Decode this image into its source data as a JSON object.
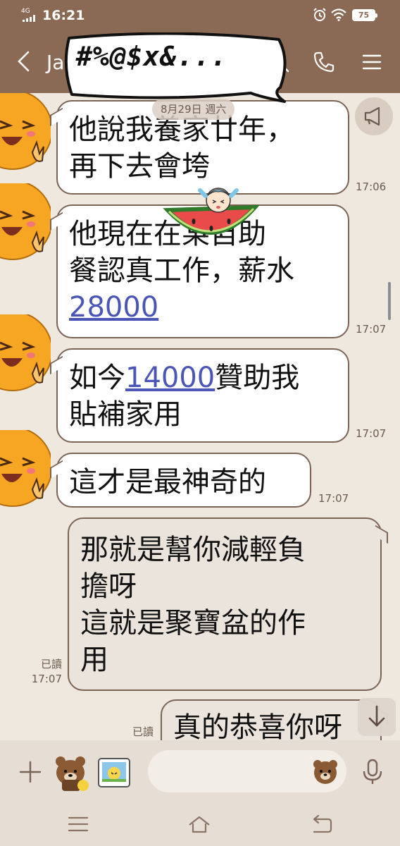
{
  "status_bar": {
    "network": "4G",
    "time": "16:21",
    "battery": "75"
  },
  "header": {
    "contact_name": "Ja"
  },
  "sticker": {
    "text": "#%@$x&..."
  },
  "chat": {
    "date_chip": "8月29日 週六",
    "messages": [
      {
        "side": "in",
        "lines": [
          "他說我養家廿年，",
          "再下去會垮"
        ],
        "time": "17:06"
      },
      {
        "side": "in",
        "pre": "他現在在某自助",
        "line2": "餐認真工作，薪水",
        "link": "28000",
        "time": "17:07"
      },
      {
        "side": "in",
        "pre": "如今",
        "link": "14000",
        "post": "贊助我",
        "line2": "貼補家用",
        "time": "17:07"
      },
      {
        "side": "in",
        "lines": [
          "這才是最神奇的"
        ],
        "time": "17:07"
      },
      {
        "side": "out",
        "lines": [
          "那就是幫你減輕負",
          "擔呀",
          "這就是聚寶盆的作",
          "用"
        ],
        "read": "已讀",
        "time": "17:07"
      },
      {
        "side": "out",
        "lines": [
          "真的恭喜你呀"
        ],
        "read": "已讀"
      }
    ]
  },
  "composer": {
    "placeholder": ""
  },
  "colors": {
    "header_bg": "#8b6a55",
    "chat_bg": "#efe8df",
    "incoming_bubble": "#ffffff",
    "outgoing_bubble": "#ebe4dd",
    "link": "#4a55b6"
  }
}
